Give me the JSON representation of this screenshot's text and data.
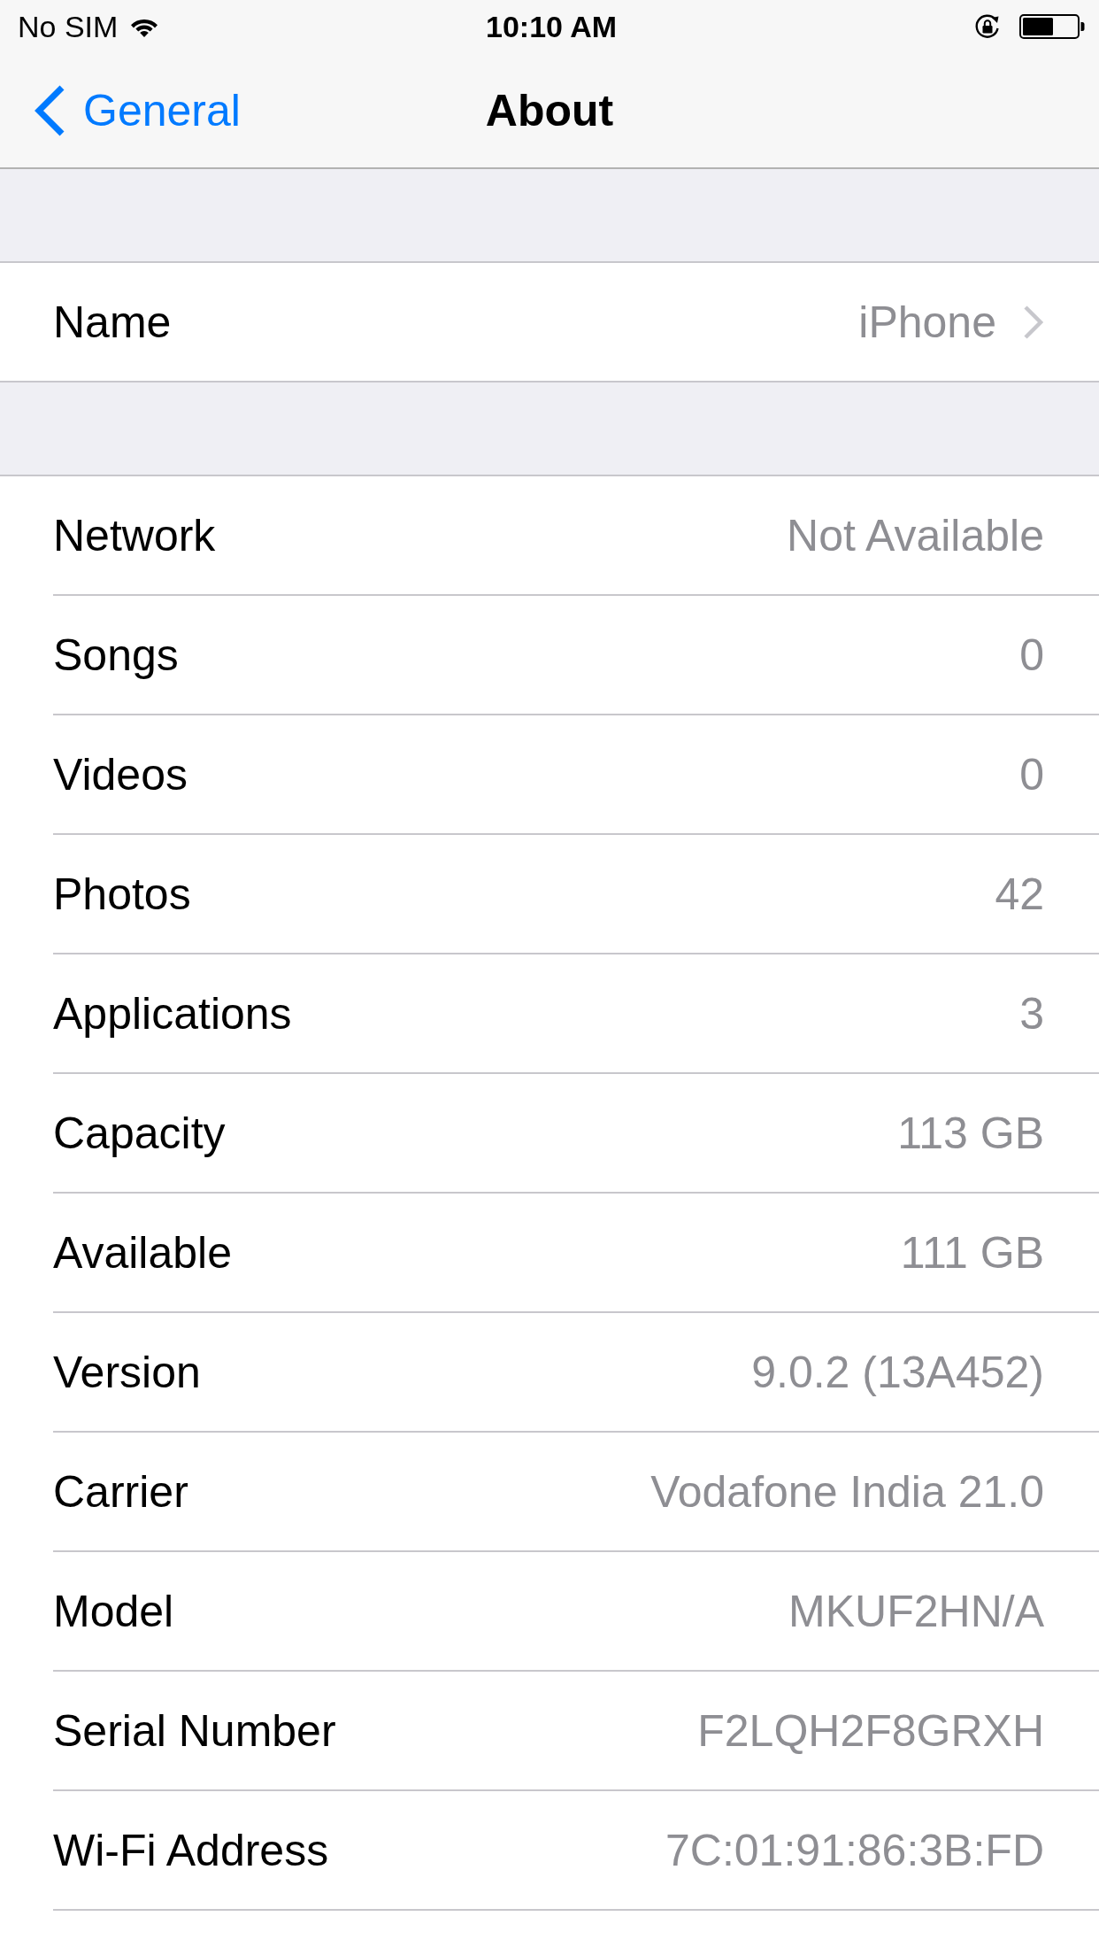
{
  "status_bar": {
    "carrier": "No SIM",
    "time": "10:10 AM"
  },
  "nav_bar": {
    "back": "General",
    "title": "About"
  },
  "groups": [
    {
      "rows": [
        {
          "kind": "disclosure",
          "label": "Name",
          "value": "iPhone"
        }
      ]
    },
    {
      "rows": [
        {
          "kind": "info",
          "label": "Network",
          "value": "Not Available"
        },
        {
          "kind": "info",
          "label": "Songs",
          "value": "0"
        },
        {
          "kind": "info",
          "label": "Videos",
          "value": "0"
        },
        {
          "kind": "info",
          "label": "Photos",
          "value": "42"
        },
        {
          "kind": "info",
          "label": "Applications",
          "value": "3"
        },
        {
          "kind": "info",
          "label": "Capacity",
          "value": "113 GB"
        },
        {
          "kind": "info",
          "label": "Available",
          "value": "111 GB"
        },
        {
          "kind": "info",
          "label": "Version",
          "value": "9.0.2 (13A452)"
        },
        {
          "kind": "info",
          "label": "Carrier",
          "value": "Vodafone India 21.0"
        },
        {
          "kind": "info",
          "label": "Model",
          "value": "MKUF2HN/A"
        },
        {
          "kind": "info",
          "label": "Serial Number",
          "value": "F2LQH2F8GRXH"
        },
        {
          "kind": "info",
          "label": "Wi-Fi Address",
          "value": "7C:01:91:86:3B:FD"
        }
      ]
    }
  ]
}
